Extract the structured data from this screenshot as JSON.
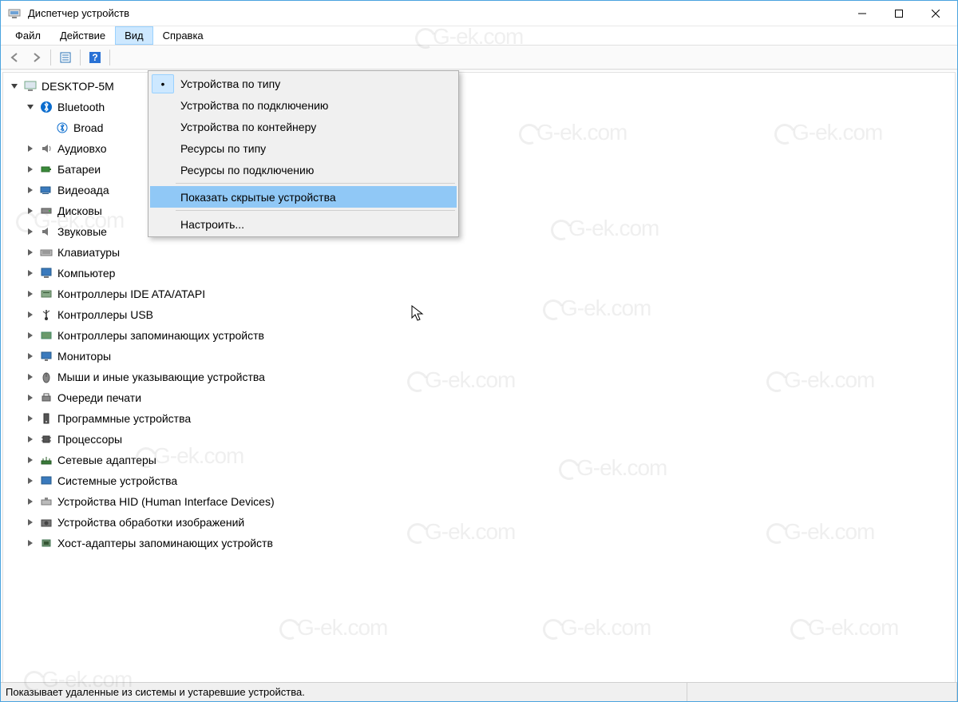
{
  "window": {
    "title": "Диспетчер устройств"
  },
  "menubar": {
    "file": "Файл",
    "action": "Действие",
    "view": "Вид",
    "help": "Справка"
  },
  "dropdown": {
    "by_type": "Устройства по типу",
    "by_connection": "Устройства по подключению",
    "by_container": "Устройства по контейнеру",
    "res_by_type": "Ресурсы по типу",
    "res_by_connection": "Ресурсы по подключению",
    "show_hidden": "Показать скрытые устройства",
    "customize": "Настроить..."
  },
  "tree": {
    "root": "DESKTOP-5M",
    "bluetooth": "Bluetooth",
    "bluetooth_child": "Broad",
    "audio_inputs": "Аудиовхо",
    "batteries": "Батареи",
    "video_adapters": "Видеоада",
    "disk_drives": "Дисковы",
    "sound_devices": "Звуковые",
    "keyboards": "Клавиатуры",
    "computer": "Компьютер",
    "ide_controllers": "Контроллеры IDE ATA/ATAPI",
    "usb_controllers": "Контроллеры USB",
    "storage_controllers": "Контроллеры запоминающих устройств",
    "monitors": "Мониторы",
    "mice": "Мыши и иные указывающие устройства",
    "print_queues": "Очереди печати",
    "software_devices": "Программные устройства",
    "processors": "Процессоры",
    "network_adapters": "Сетевые адаптеры",
    "system_devices": "Системные устройства",
    "hid_devices": "Устройства HID (Human Interface Devices)",
    "imaging_devices": "Устройства обработки изображений",
    "host_adapters": "Хост-адаптеры запоминающих устройств"
  },
  "statusbar": {
    "text": "Показывает удаленные из системы и устаревшие устройства."
  },
  "watermark": "G-ek.com"
}
